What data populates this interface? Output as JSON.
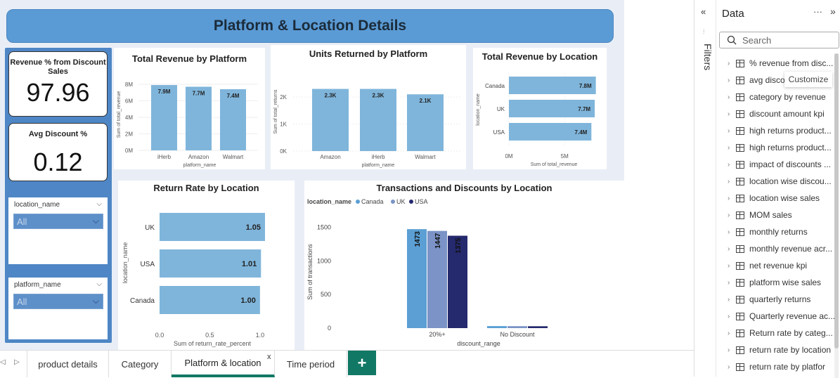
{
  "page_title": "Platform & Location Details",
  "kpis": {
    "revenue_label": "Revenue % from Discount Sales",
    "revenue_value": "97.96",
    "discount_label": "Avg Discount %",
    "discount_value": "0.12"
  },
  "slicers": {
    "location": {
      "title": "location_name",
      "value": "All"
    },
    "platform": {
      "title": "platform_name",
      "value": "All"
    }
  },
  "charts": {
    "platform_revenue": {
      "title": "Total Revenue by Platform",
      "ylabel": "Sum of total_revenue",
      "xlabel": "platform_name",
      "yticks": [
        "0M",
        "2M",
        "4M",
        "6M",
        "8M"
      ]
    },
    "units_returned": {
      "title": "Units Returned by Platform",
      "ylabel": "Sum of total_returns",
      "xlabel": "platform_name",
      "yticks": [
        "0K",
        "1K",
        "2K"
      ]
    },
    "location_revenue": {
      "title": "Total Revenue by Location",
      "ylabel": "location_name",
      "xlabel": "Sum of total_revenue",
      "xticks": [
        "0M",
        "5M"
      ]
    },
    "return_rate": {
      "title": "Return Rate by Location",
      "ylabel": "location_name",
      "xlabel": "Sum of return_rate_percent",
      "xticks": [
        "0.0",
        "0.5",
        "1.0"
      ]
    },
    "transactions": {
      "title": "Transactions and Discounts by Location",
      "legend_title": "location_name",
      "ylabel": "Sum of transactions",
      "xlabel": "discount_range",
      "yticks": [
        "0",
        "500",
        "1000",
        "1500"
      ]
    }
  },
  "chart_data": [
    {
      "type": "bar",
      "title": "Total Revenue by Platform",
      "categories": [
        "iHerb",
        "Amazon",
        "Walmart"
      ],
      "values": [
        7.9,
        7.7,
        7.4
      ],
      "labels": [
        "7.9M",
        "7.7M",
        "7.4M"
      ],
      "ylim": [
        0,
        8.5
      ],
      "unit": "M"
    },
    {
      "type": "bar",
      "title": "Units Returned by Platform",
      "categories": [
        "Amazon",
        "iHerb",
        "Walmart"
      ],
      "values": [
        2300,
        2300,
        2100
      ],
      "labels": [
        "2.3K",
        "2.3K",
        "2.1K"
      ],
      "ylim": [
        0,
        2600
      ]
    },
    {
      "type": "bar",
      "orientation": "horizontal",
      "title": "Total Revenue by Location",
      "categories": [
        "Canada",
        "UK",
        "USA"
      ],
      "values": [
        7.8,
        7.7,
        7.4
      ],
      "labels": [
        "7.8M",
        "7.7M",
        "7.4M"
      ],
      "xlim": [
        0,
        8.2
      ],
      "unit": "M"
    },
    {
      "type": "bar",
      "orientation": "horizontal",
      "title": "Return Rate by Location",
      "categories": [
        "UK",
        "USA",
        "Canada"
      ],
      "values": [
        1.05,
        1.01,
        1.0
      ],
      "labels": [
        "1.05",
        "1.01",
        "1.00"
      ],
      "xlim": [
        0,
        1.05
      ]
    },
    {
      "type": "bar",
      "title": "Transactions and Discounts by Location",
      "categories": [
        "20%+",
        "No Discount"
      ],
      "series": [
        {
          "name": "Canada",
          "color": "#5b9fd4",
          "values": [
            1473,
            30
          ]
        },
        {
          "name": "UK",
          "color": "#7b93c6",
          "values": [
            1447,
            29
          ]
        },
        {
          "name": "USA",
          "color": "#25296e",
          "values": [
            1375,
            28
          ]
        }
      ],
      "labels": [
        "1473",
        "1447",
        "1375"
      ],
      "ylim": [
        0,
        1600
      ],
      "legend": "top-left"
    }
  ],
  "tabs": [
    "product details",
    "Category",
    "Platform & location",
    "Time period"
  ],
  "add_tab": "+",
  "filters_label": "Filters",
  "data_pane": {
    "title": "Data",
    "more": "···",
    "expand": "»",
    "collapse": "«",
    "search_placeholder": "Search",
    "tooltip": "Customize",
    "fields": [
      "% revenue from disc...",
      "avg disco",
      "category by revenue",
      "discount amount kpi",
      "high returns product...",
      "high returns product...",
      "impact of discounts ...",
      "location wise discou...",
      "location wise sales",
      "MOM sales",
      "monthly returns",
      "monthly revenue acr...",
      "net revenue kpi",
      "platform wise sales",
      "quarterly returns",
      "Quarterly revenue ac...",
      "Return rate by categ...",
      "return rate by location",
      "return rate by platfor"
    ]
  },
  "colors": {
    "bar": "#7fb5db",
    "header": "#5b9bd5",
    "panel": "#4e86c6",
    "tab_active": "#117865"
  }
}
